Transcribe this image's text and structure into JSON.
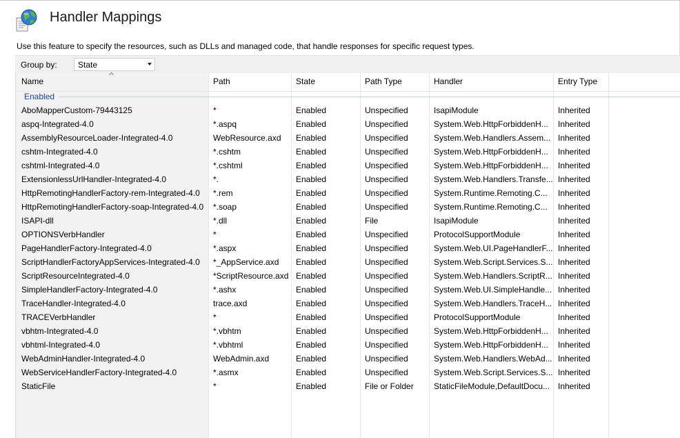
{
  "header": {
    "title": "Handler Mappings",
    "icon": "globe-page-icon"
  },
  "description": "Use this feature to specify the resources, such as DLLs and managed code, that handle responses for specific request types.",
  "toolbar": {
    "group_by_label": "Group by:",
    "group_by_value": "State"
  },
  "table": {
    "columns": [
      "Name",
      "Path",
      "State",
      "Path Type",
      "Handler",
      "Entry Type"
    ],
    "group_label": "Enabled",
    "rows": [
      [
        "AboMapperCustom-79443125",
        "*",
        "Enabled",
        "Unspecified",
        "IsapiModule",
        "Inherited"
      ],
      [
        "aspq-Integrated-4.0",
        "*.aspq",
        "Enabled",
        "Unspecified",
        "System.Web.HttpForbiddenH...",
        "Inherited"
      ],
      [
        "AssemblyResourceLoader-Integrated-4.0",
        "WebResource.axd",
        "Enabled",
        "Unspecified",
        "System.Web.Handlers.Assem...",
        "Inherited"
      ],
      [
        "cshtm-Integrated-4.0",
        "*.cshtm",
        "Enabled",
        "Unspecified",
        "System.Web.HttpForbiddenH...",
        "Inherited"
      ],
      [
        "cshtml-Integrated-4.0",
        "*.cshtml",
        "Enabled",
        "Unspecified",
        "System.Web.HttpForbiddenH...",
        "Inherited"
      ],
      [
        "ExtensionlessUrlHandler-Integrated-4.0",
        "*.",
        "Enabled",
        "Unspecified",
        "System.Web.Handlers.Transfe...",
        "Inherited"
      ],
      [
        "HttpRemotingHandlerFactory-rem-Integrated-4.0",
        "*.rem",
        "Enabled",
        "Unspecified",
        "System.Runtime.Remoting.C...",
        "Inherited"
      ],
      [
        "HttpRemotingHandlerFactory-soap-Integrated-4.0",
        "*.soap",
        "Enabled",
        "Unspecified",
        "System.Runtime.Remoting.C...",
        "Inherited"
      ],
      [
        "ISAPI-dll",
        "*.dll",
        "Enabled",
        "File",
        "IsapiModule",
        "Inherited"
      ],
      [
        "OPTIONSVerbHandler",
        "*",
        "Enabled",
        "Unspecified",
        "ProtocolSupportModule",
        "Inherited"
      ],
      [
        "PageHandlerFactory-Integrated-4.0",
        "*.aspx",
        "Enabled",
        "Unspecified",
        "System.Web.UI.PageHandlerF...",
        "Inherited"
      ],
      [
        "ScriptHandlerFactoryAppServices-Integrated-4.0",
        "*_AppService.axd",
        "Enabled",
        "Unspecified",
        "System.Web.Script.Services.S...",
        "Inherited"
      ],
      [
        "ScriptResourceIntegrated-4.0",
        "*ScriptResource.axd",
        "Enabled",
        "Unspecified",
        "System.Web.Handlers.ScriptR...",
        "Inherited"
      ],
      [
        "SimpleHandlerFactory-Integrated-4.0",
        "*.ashx",
        "Enabled",
        "Unspecified",
        "System.Web.UI.SimpleHandle...",
        "Inherited"
      ],
      [
        "TraceHandler-Integrated-4.0",
        "trace.axd",
        "Enabled",
        "Unspecified",
        "System.Web.Handlers.TraceH...",
        "Inherited"
      ],
      [
        "TRACEVerbHandler",
        "*",
        "Enabled",
        "Unspecified",
        "ProtocolSupportModule",
        "Inherited"
      ],
      [
        "vbhtm-Integrated-4.0",
        "*.vbhtm",
        "Enabled",
        "Unspecified",
        "System.Web.HttpForbiddenH...",
        "Inherited"
      ],
      [
        "vbhtml-Integrated-4.0",
        "*.vbhtml",
        "Enabled",
        "Unspecified",
        "System.Web.HttpForbiddenH...",
        "Inherited"
      ],
      [
        "WebAdminHandler-Integrated-4.0",
        "WebAdmin.axd",
        "Enabled",
        "Unspecified",
        "System.Web.Handlers.WebAd...",
        "Inherited"
      ],
      [
        "WebServiceHandlerFactory-Integrated-4.0",
        "*.asmx",
        "Enabled",
        "Unspecified",
        "System.Web.Script.Services.S...",
        "Inherited"
      ],
      [
        "StaticFile",
        "*",
        "Enabled",
        "File or Folder",
        "StaticFileModule,DefaultDocu...",
        "Inherited"
      ]
    ]
  },
  "colors": {
    "group_header": "#1e3f8c",
    "name_column_background": "#f2f2f2",
    "toolbar_background": "#f0f0f0"
  }
}
